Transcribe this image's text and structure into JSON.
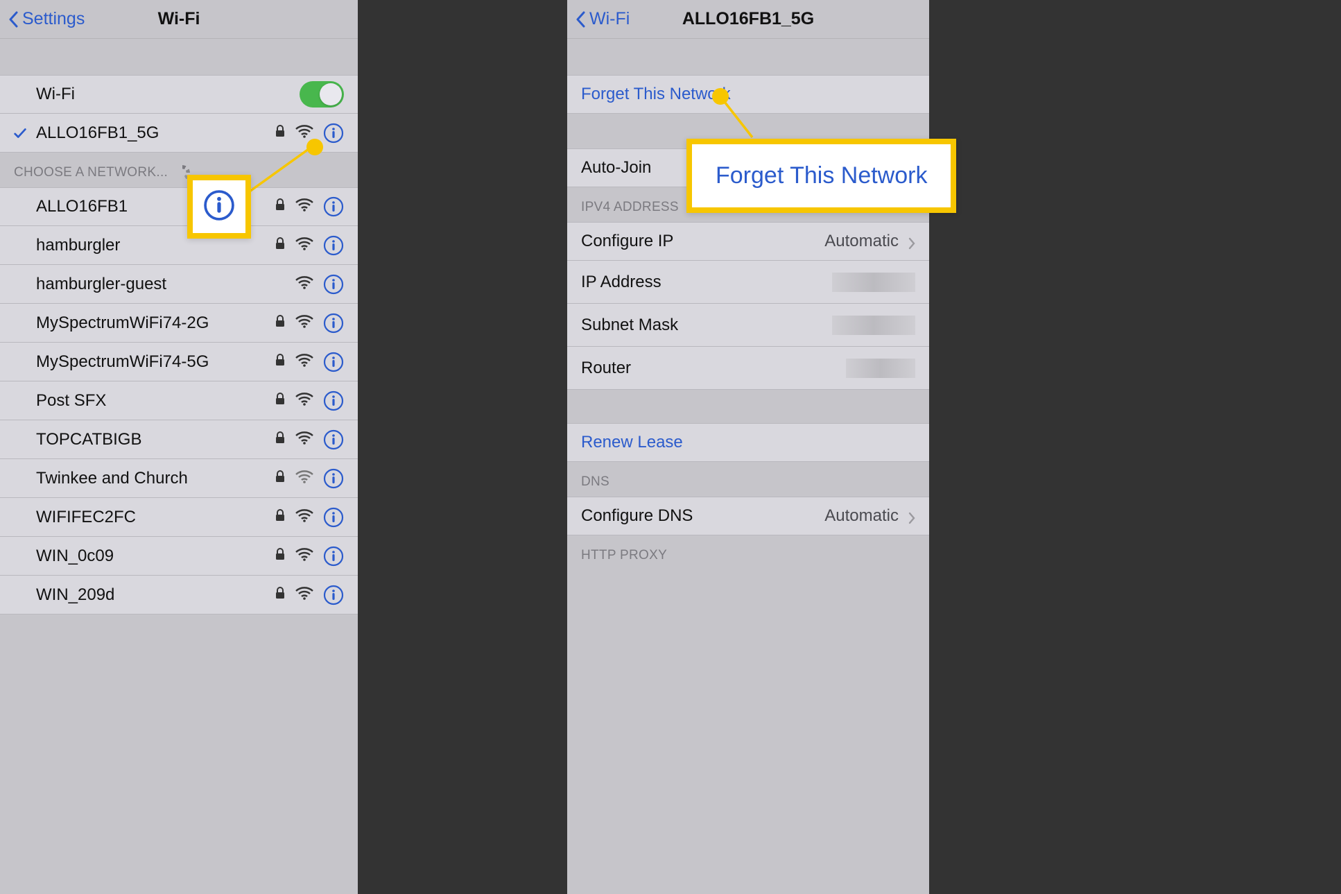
{
  "left": {
    "nav": {
      "back": "Settings",
      "title": "Wi-Fi"
    },
    "wifi_toggle": {
      "label": "Wi-Fi",
      "on": true
    },
    "connected": {
      "ssid": "ALLO16FB1_5G",
      "locked": true
    },
    "choose_header": "CHOOSE A NETWORK...",
    "networks": [
      {
        "ssid": "ALLO16FB1",
        "locked": true,
        "strength": "full"
      },
      {
        "ssid": "hamburgler",
        "locked": true,
        "strength": "full"
      },
      {
        "ssid": "hamburgler-guest",
        "locked": false,
        "strength": "full"
      },
      {
        "ssid": "MySpectrumWiFi74-2G",
        "locked": true,
        "strength": "full"
      },
      {
        "ssid": "MySpectrumWiFi74-5G",
        "locked": true,
        "strength": "full"
      },
      {
        "ssid": "Post SFX",
        "locked": true,
        "strength": "full"
      },
      {
        "ssid": "TOPCATBIGB",
        "locked": true,
        "strength": "full"
      },
      {
        "ssid": "Twinkee and Church",
        "locked": true,
        "strength": "mid"
      },
      {
        "ssid": "WIFIFEC2FC",
        "locked": true,
        "strength": "full"
      },
      {
        "ssid": "WIN_0c09",
        "locked": true,
        "strength": "full"
      },
      {
        "ssid": "WIN_209d",
        "locked": true,
        "strength": "full"
      }
    ]
  },
  "right": {
    "nav": {
      "back": "Wi-Fi",
      "title": "ALLO16FB1_5G"
    },
    "forget": "Forget This Network",
    "auto_join": "Auto-Join",
    "ipv4_header": "IPV4 ADDRESS",
    "configure_ip": {
      "label": "Configure IP",
      "value": "Automatic"
    },
    "ip_address": "IP Address",
    "subnet": "Subnet Mask",
    "router": "Router",
    "renew": "Renew Lease",
    "dns_header": "DNS",
    "configure_dns": {
      "label": "Configure DNS",
      "value": "Automatic"
    },
    "http_proxy_header": "HTTP PROXY"
  },
  "callouts": {
    "forget_big": "Forget This Network"
  }
}
